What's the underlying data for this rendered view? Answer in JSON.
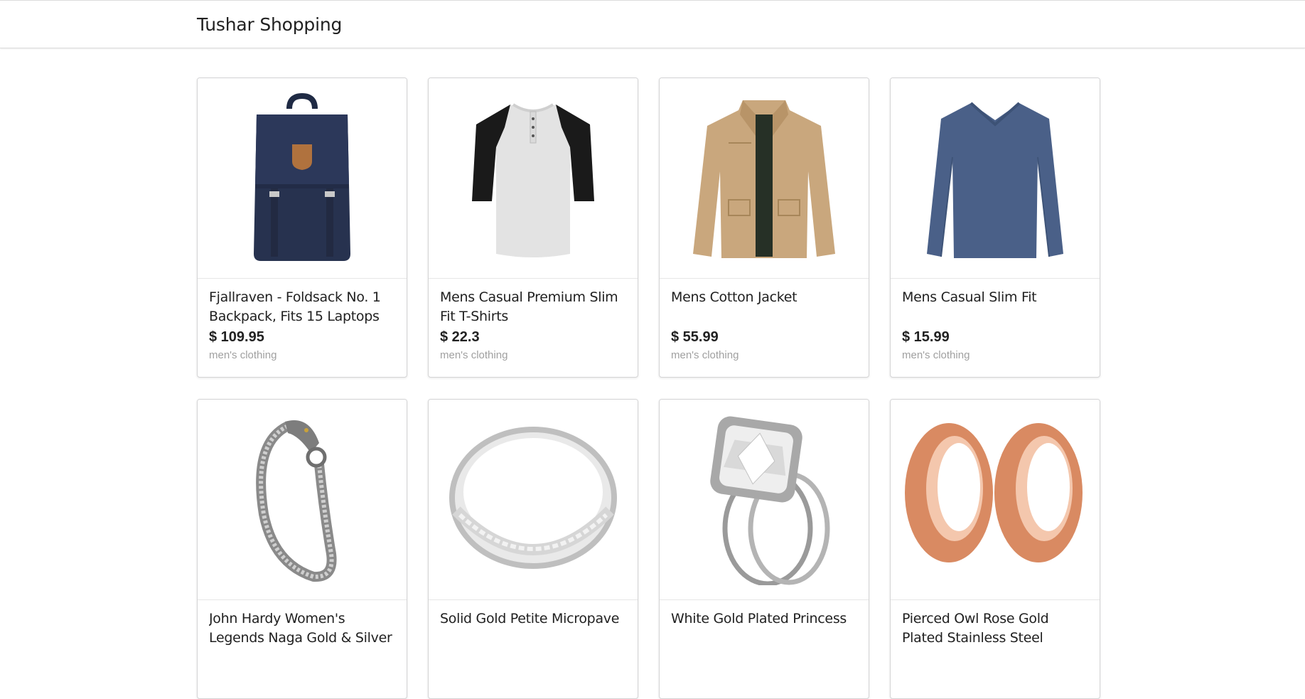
{
  "header": {
    "title": "Tushar Shopping"
  },
  "products": [
    {
      "title": "Fjallraven - Foldsack No. 1 Backpack, Fits 15 Laptops",
      "price": "$ 109.95",
      "category": "men's clothing",
      "image": "backpack"
    },
    {
      "title": "Mens Casual Premium Slim Fit T-Shirts",
      "price": "$ 22.3",
      "category": "men's clothing",
      "image": "raglan-tshirt"
    },
    {
      "title": "Mens Cotton Jacket",
      "price": "$ 55.99",
      "category": "men's clothing",
      "image": "jacket"
    },
    {
      "title": "Mens Casual Slim Fit",
      "price": "$ 15.99",
      "category": "men's clothing",
      "image": "longsleeve-shirt"
    },
    {
      "title": "John Hardy Women's Legends Naga Gold & Silver",
      "price": "",
      "category": "",
      "image": "bracelet"
    },
    {
      "title": "Solid Gold Petite Micropave",
      "price": "",
      "category": "",
      "image": "silver-ring"
    },
    {
      "title": "White Gold Plated Princess",
      "price": "",
      "category": "",
      "image": "diamond-ring"
    },
    {
      "title": "Pierced Owl Rose Gold Plated Stainless Steel",
      "price": "",
      "category": "",
      "image": "rose-gold-tunnels"
    }
  ]
}
